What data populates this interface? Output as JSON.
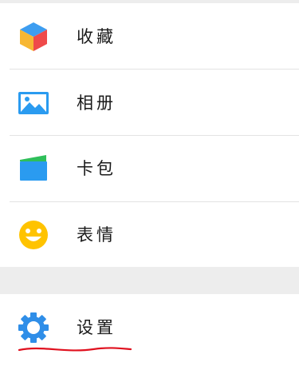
{
  "menu": {
    "items": [
      {
        "label": "收藏",
        "icon": "favorites-cube-icon"
      },
      {
        "label": "相册",
        "icon": "photo-album-icon"
      },
      {
        "label": "卡包",
        "icon": "card-wallet-icon"
      },
      {
        "label": "表情",
        "icon": "emoji-smile-icon"
      }
    ],
    "settings": {
      "label": "设置",
      "icon": "gear-icon"
    }
  },
  "colors": {
    "background": "#ededed",
    "row": "#ffffff",
    "divider": "#e3e3e3",
    "gear_blue": "#2f8ee8",
    "album_blue": "#2a9bf0",
    "wallet_blue": "#2a9bf0",
    "wallet_green": "#2fbf5a",
    "emoji_yellow": "#ffc300",
    "annotation_red": "#e0101e"
  }
}
